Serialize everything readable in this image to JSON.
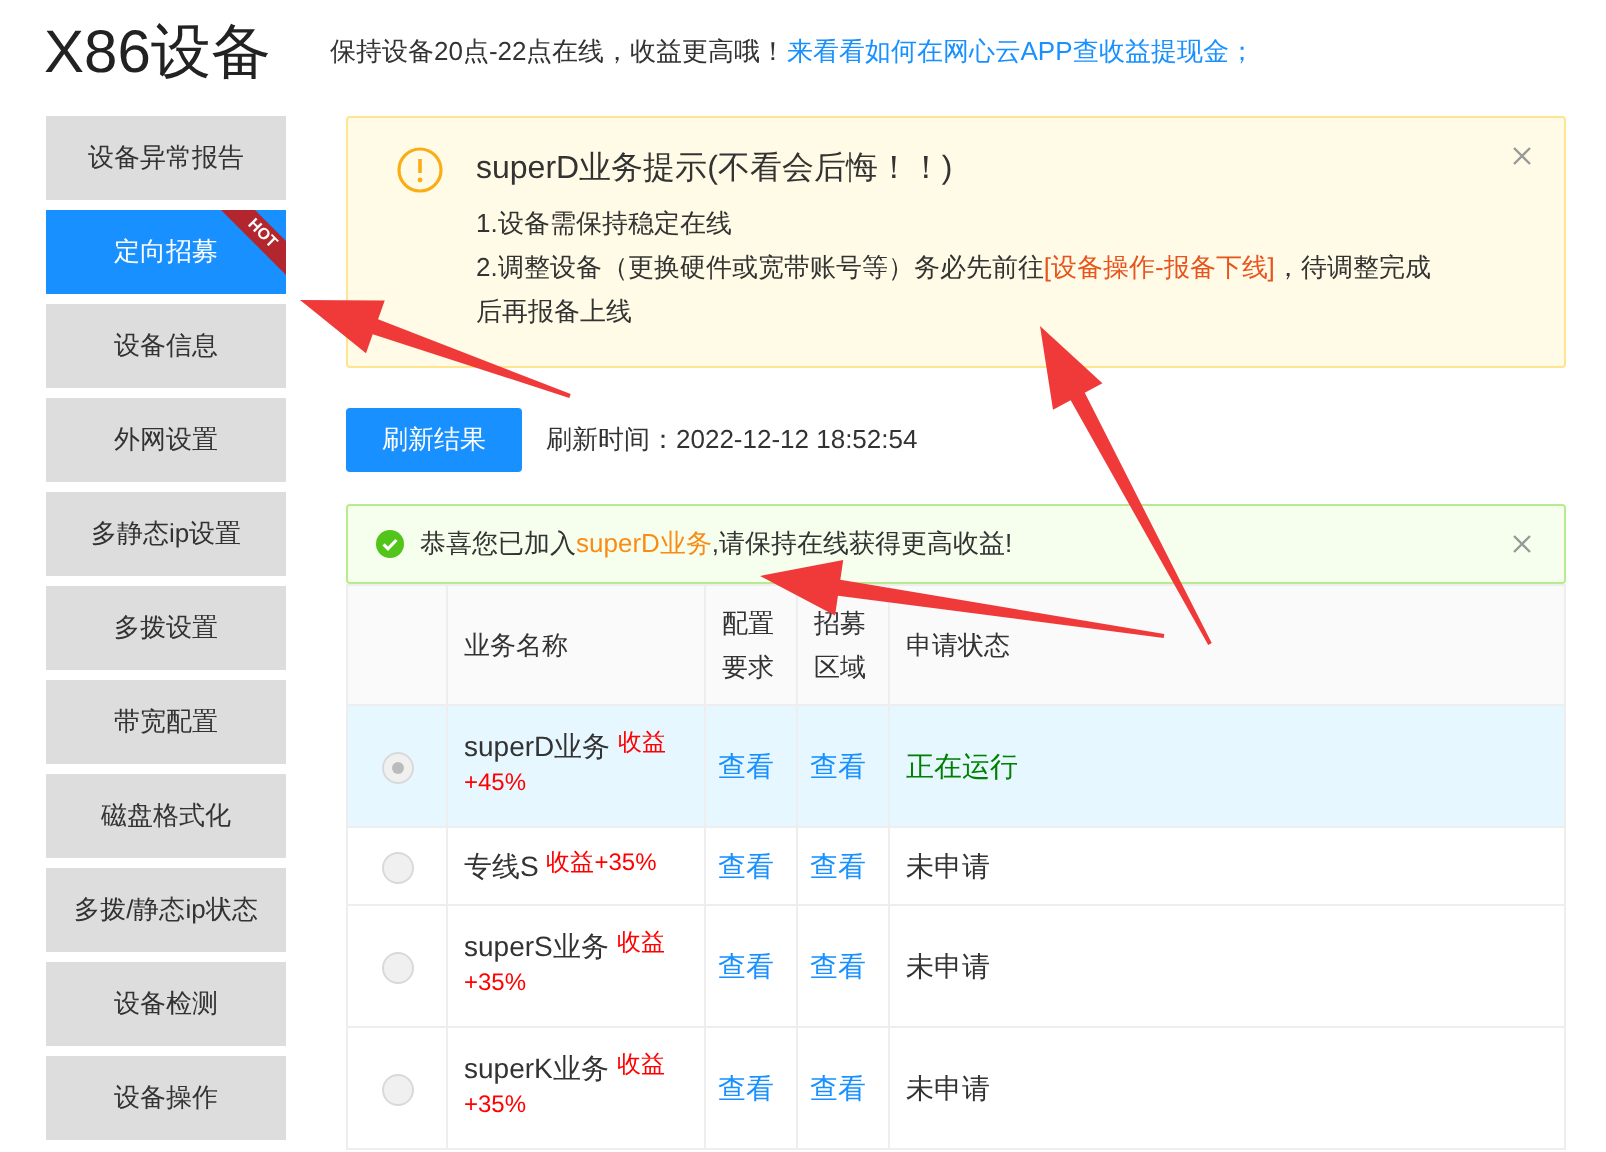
{
  "header": {
    "title": "X86设备",
    "notice": "保持设备20点-22点在线，收益更高哦！",
    "notice_link": "来看看如何在网心云APP查收益提现金；"
  },
  "sidebar": {
    "items": [
      {
        "label": "设备异常报告",
        "selected": false
      },
      {
        "label": "定向招募",
        "selected": true,
        "ribbon": "HOT"
      },
      {
        "label": "设备信息",
        "selected": false
      },
      {
        "label": "外网设置",
        "selected": false
      },
      {
        "label": "多静态ip设置",
        "selected": false
      },
      {
        "label": "多拨设置",
        "selected": false
      },
      {
        "label": "带宽配置",
        "selected": false
      },
      {
        "label": "磁盘格式化",
        "selected": false
      },
      {
        "label": "多拨/静态ip状态",
        "selected": false
      },
      {
        "label": "设备检测",
        "selected": false
      },
      {
        "label": "设备操作",
        "selected": false
      }
    ]
  },
  "warning": {
    "title": "superD业务提示(不看会后悔！！)",
    "line_1": "1.设备需保持稳定在线",
    "line_2_before": "2.调整设备（更换硬件或宽带账号等）务必先前往",
    "line_2_highlight": "[设备操作-报备下线]",
    "line_2_after": "，待调整完成后再报备上线"
  },
  "refresh": {
    "button": "刷新结果",
    "label": "刷新时间：",
    "time": "2022-12-12 18:52:54"
  },
  "success": {
    "before": "恭喜您已加入",
    "highlight": "superD业务",
    "after": ",请保持在线获得更高收益!"
  },
  "table": {
    "columns": [
      "业务名称",
      "配置要求",
      "招募区域",
      "申请状态"
    ],
    "rows": [
      {
        "selected": true,
        "name": "superD业务",
        "tag": "收益+45%",
        "config": "查看",
        "region": "查看",
        "status": "正在运行",
        "running": true
      },
      {
        "selected": false,
        "name": "专线S",
        "tag": "收益+35%",
        "config": "查看",
        "region": "查看",
        "status": "未申请",
        "running": false
      },
      {
        "selected": false,
        "name": "superS业务",
        "tag": "收益+35%",
        "config": "查看",
        "region": "查看",
        "status": "未申请",
        "running": false
      },
      {
        "selected": false,
        "name": "superK业务",
        "tag": "收益+35%",
        "config": "查看",
        "region": "查看",
        "status": "未申请",
        "running": false
      }
    ]
  }
}
